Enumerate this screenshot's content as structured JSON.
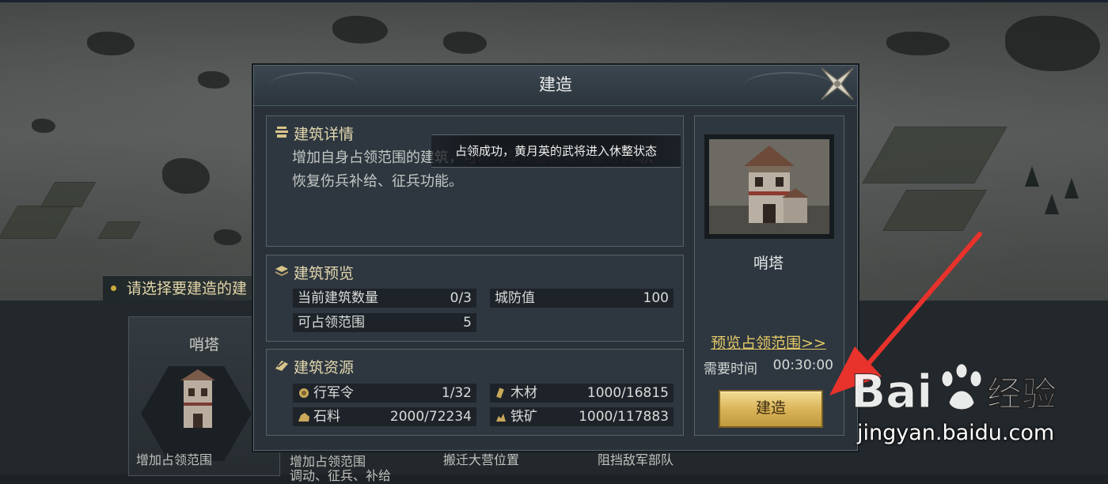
{
  "hint": {
    "text": "请选择要建造的建"
  },
  "bottom_cards": {
    "card1_title": "哨塔",
    "descriptions": [
      "增加占领范围",
      "增加占领范围",
      "搬迁大营位置",
      "阻挡敌军部队"
    ],
    "desc2_line2": "调动、征兵、补给"
  },
  "dialog": {
    "title": "建造",
    "close_icon": "close-x-icon",
    "detail": {
      "title": "建筑详情",
      "description": "增加自身占领范围的建筑，可以为军队提供解除疲劳调动、恢复伤兵补给、征兵功能。"
    },
    "preview": {
      "title": "建筑预览",
      "rows": [
        {
          "label": "当前建筑数量",
          "value": "0/3"
        },
        {
          "label": "城防值",
          "value": "100"
        },
        {
          "label": "可占领范围",
          "value": "5"
        }
      ]
    },
    "resources": {
      "title": "建筑资源",
      "rows": [
        {
          "icon": "march-order-icon",
          "label": "行军令",
          "value": "1/32"
        },
        {
          "icon": "wood-icon",
          "label": "木材",
          "value": "1000/16815"
        },
        {
          "icon": "stone-icon",
          "label": "石料",
          "value": "2000/72234"
        },
        {
          "icon": "iron-icon",
          "label": "铁矿",
          "value": "1000/117883"
        }
      ]
    },
    "side": {
      "building_name": "哨塔",
      "preview_link": "预览占领范围>>",
      "time_label": "需要时间",
      "time_value": "00:30:00",
      "build_button": "建造"
    }
  },
  "toast": {
    "text": "占领成功，黄月英的武将进入休整状态"
  },
  "watermark": {
    "logo_text": "Baidu经验",
    "url": "jingyan.baidu.com"
  },
  "colors": {
    "accent_gold": "#e2d7ae",
    "button_gold": "#d8b155",
    "arrow_red": "#e8322c"
  }
}
